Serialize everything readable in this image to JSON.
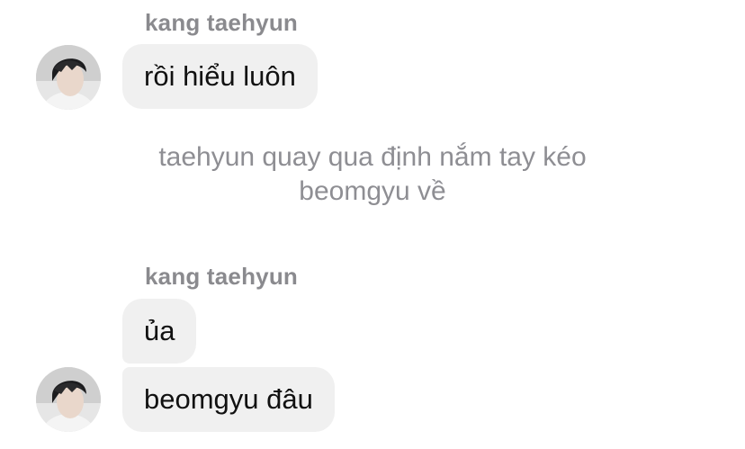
{
  "messages": [
    {
      "sender": "kang taehyun",
      "bubbles": [
        "rồi hiểu luôn"
      ]
    },
    {
      "sender": "kang taehyun",
      "bubbles": [
        "ủa",
        "beomgyu đâu"
      ]
    }
  ],
  "narration": {
    "line1": "taehyun quay qua định nắm tay kéo",
    "line2": "beomgyu về"
  },
  "colors": {
    "bubble_bg": "#f0f0f0",
    "meta_text": "#8a8a8e",
    "message_text": "#111111"
  },
  "icons": {
    "avatar": "profile-photo"
  }
}
